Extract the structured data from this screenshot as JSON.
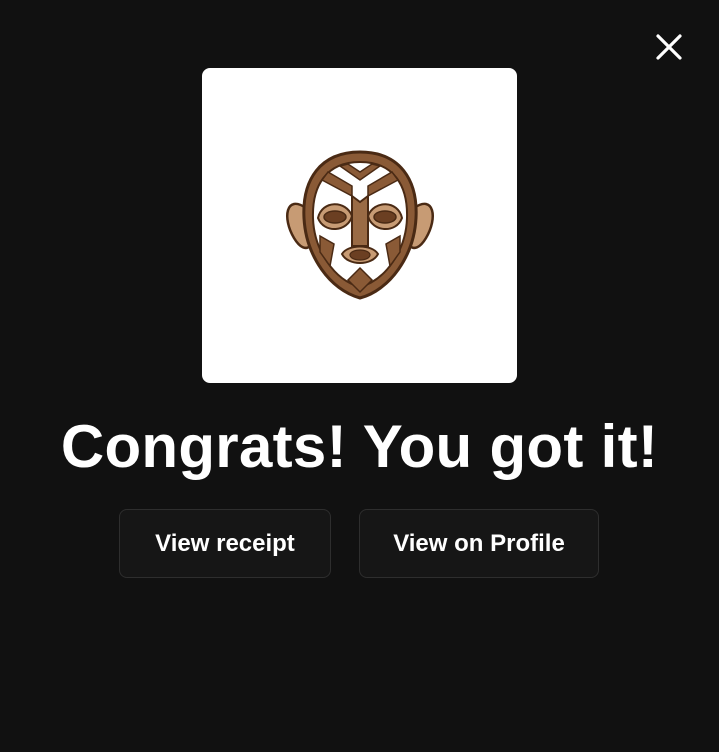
{
  "modal": {
    "close_icon": "close-icon",
    "artwork": {
      "icon": "tribal-mask-icon",
      "colors": {
        "card_bg": "#ffffff",
        "brown_dark": "#6b3f22",
        "brown_mid": "#9a6b45",
        "brown_light": "#c79b74",
        "outline": "#4a2a14"
      }
    },
    "headline": "Congrats! You got it!",
    "buttons": {
      "view_receipt": "View receipt",
      "view_on_profile": "View on Profile"
    }
  },
  "colors": {
    "background": "#111111",
    "button_bg": "#161616",
    "button_border": "#2e2e2e",
    "text": "#ffffff"
  }
}
